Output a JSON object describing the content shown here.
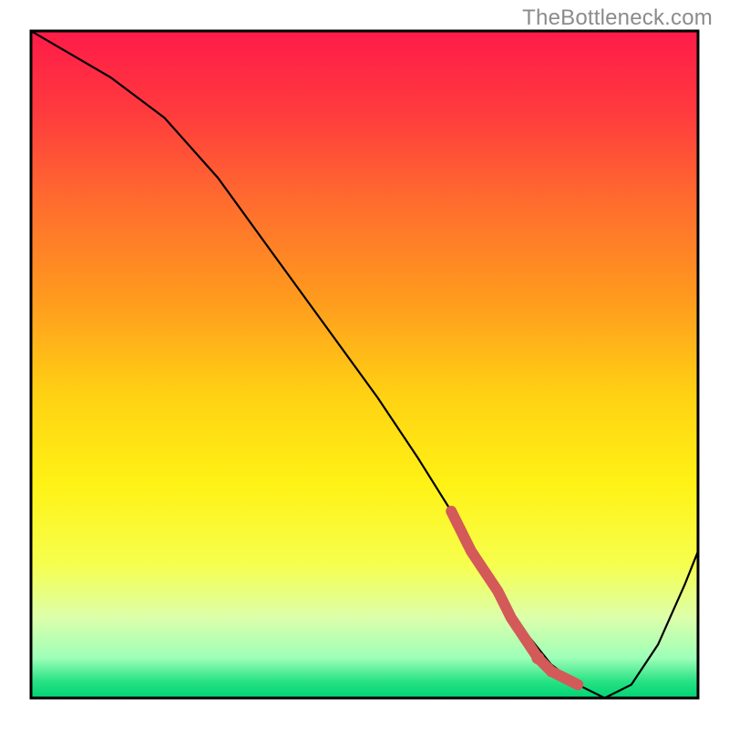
{
  "watermark": "TheBottleneck.com",
  "colors": {
    "border": "#000000",
    "curve": "#000000",
    "dotted_segment": "#d35a58",
    "gradient_stops": [
      {
        "offset": 0.0,
        "color": "#ff1b49"
      },
      {
        "offset": 0.12,
        "color": "#ff3a3e"
      },
      {
        "offset": 0.25,
        "color": "#ff6a2f"
      },
      {
        "offset": 0.4,
        "color": "#ff9a1e"
      },
      {
        "offset": 0.55,
        "color": "#ffd313"
      },
      {
        "offset": 0.68,
        "color": "#fff215"
      },
      {
        "offset": 0.8,
        "color": "#f6ff4e"
      },
      {
        "offset": 0.88,
        "color": "#dcffab"
      },
      {
        "offset": 0.94,
        "color": "#9dffb8"
      },
      {
        "offset": 0.975,
        "color": "#28e284"
      },
      {
        "offset": 1.0,
        "color": "#00d375"
      }
    ]
  },
  "chart_data": {
    "type": "line",
    "title": "",
    "xlabel": "",
    "ylabel": "",
    "xlim": [
      0,
      100
    ],
    "ylim": [
      0,
      100
    ],
    "series": [
      {
        "name": "bottleneck-curve",
        "x": [
          0,
          12,
          20,
          28,
          36,
          44,
          52,
          58,
          63,
          66,
          70,
          74,
          78,
          82,
          86,
          90,
          94,
          98,
          100
        ],
        "values": [
          100,
          93,
          87,
          78,
          67,
          56,
          45,
          36,
          28,
          22,
          16,
          10,
          5,
          2,
          0,
          2,
          8,
          17,
          22
        ]
      }
    ],
    "highlight_segment": {
      "name": "dotted-highlight",
      "comment": "thick salmon dotted portion of the curve near the minimum",
      "x": [
        63,
        66,
        70,
        72,
        74,
        76,
        78,
        80,
        82
      ],
      "values": [
        28,
        22,
        16,
        12,
        9,
        6,
        4,
        3,
        2
      ]
    }
  }
}
